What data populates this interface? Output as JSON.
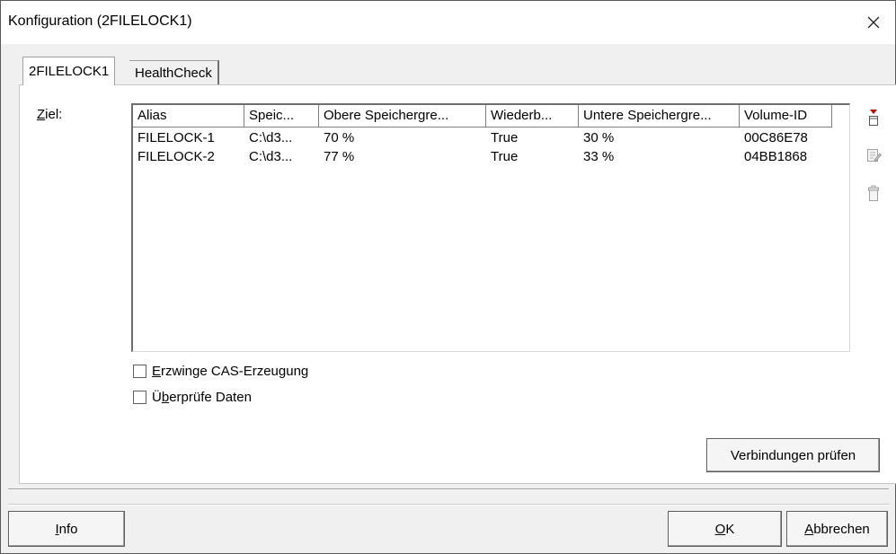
{
  "window": {
    "title": "Konfiguration (2FILELOCK1)"
  },
  "tabs": [
    {
      "label": "2FILELOCK1",
      "active": true
    },
    {
      "label": "HealthCheck",
      "active": false
    }
  ],
  "target": {
    "label_mnemonic": "Z",
    "label_rest": "iel:",
    "columns": [
      "Alias",
      "Speic...",
      "Obere Speichergre...",
      "Wiederb...",
      "Untere Speichergre...",
      "Volume-ID"
    ],
    "rows": [
      [
        "FILELOCK-1",
        "C:\\d3...",
        "70 %",
        "True",
        "30 %",
        "00C86E78"
      ],
      [
        "FILELOCK-2",
        "C:\\d3...",
        "77 %",
        "True",
        "33 %",
        "04BB1868"
      ]
    ]
  },
  "side_buttons": [
    {
      "icon": "add-icon",
      "enabled": true
    },
    {
      "icon": "edit-icon",
      "enabled": false
    },
    {
      "icon": "delete-icon",
      "enabled": false
    }
  ],
  "options": {
    "force_cas": {
      "mnemonic": "E",
      "rest": "rzwinge CAS-Erzeugung",
      "checked": false
    },
    "verify_data": {
      "pre": "Ü",
      "mnemonic": "b",
      "rest": "erprüfe Daten",
      "checked": false
    }
  },
  "buttons": {
    "check_connections": "Verbindungen prüfen",
    "info_mnemonic": "I",
    "info_rest": "nfo",
    "ok_mnemonic": "O",
    "ok_rest": "K",
    "cancel_mnemonic": "A",
    "cancel_rest": "bbrechen"
  },
  "colors": {
    "accent_red": "#d00000",
    "disabled_gray": "#a0a0a0"
  }
}
